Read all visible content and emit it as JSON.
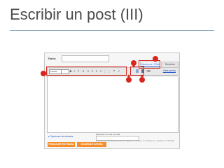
{
  "slide": {
    "title": "Escribir un post (III)"
  },
  "editor": {
    "title_label": "Título:",
    "tab_html": "Edición de HTML",
    "tab_compose": "Redactar",
    "font_select": "Fuente",
    "preview_link": "Vista previa",
    "post_options": "Opciones de entrada",
    "labels_title": "Etiquetas de esta entrada:",
    "shortcuts": "Accesos directos: pulse Ctrl con: B = Negrita, I = Cursiva, P = Publicar, S = Guardar, D = Borrador",
    "publish_button": "PUBLICAR ENTRADA",
    "save_button": "GUARDAR AHORA"
  },
  "colors": {
    "callout": "#d7261e",
    "action": "#f58d2a",
    "link": "#1a55c6"
  }
}
